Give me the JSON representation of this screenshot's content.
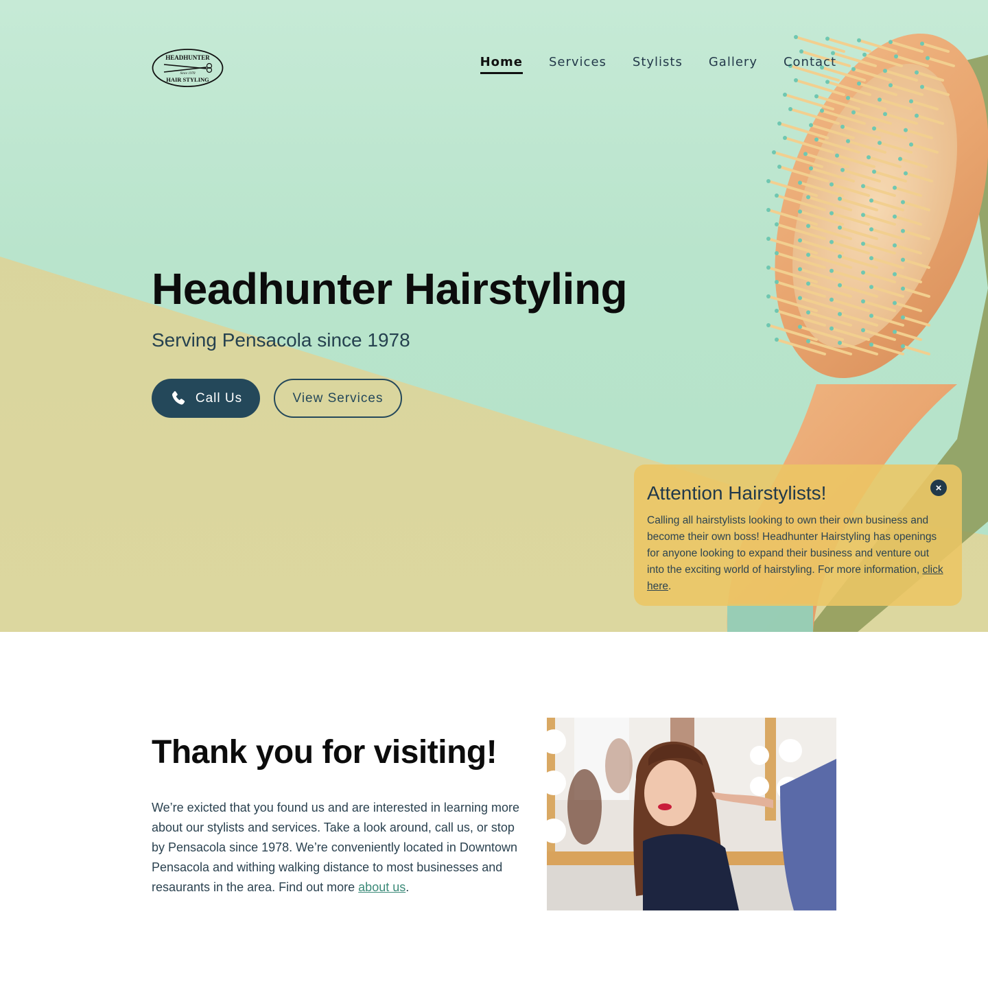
{
  "brand": {
    "logo_top": "HEADHUNTER",
    "logo_since": "Since 1978",
    "logo_bottom": "HAIR STYLING"
  },
  "nav": {
    "items": [
      {
        "label": "Home",
        "active": true
      },
      {
        "label": "Services",
        "active": false
      },
      {
        "label": "Stylists",
        "active": false
      },
      {
        "label": "Gallery",
        "active": false
      },
      {
        "label": "Contact",
        "active": false
      }
    ]
  },
  "hero": {
    "title": "Headhunter Hairstyling",
    "subtitle": "Serving Pensacola since 1978",
    "call_button": "Call Us",
    "call_icon": "phone-icon",
    "services_button": "View Services"
  },
  "notice": {
    "title": "Attention Hairstylists!",
    "body": "Calling all hairstylists looking to own their own business and become their own boss! Headhunter Hairstyling has openings for anyone looking to expand their business and venture out into the exciting world of hairstyling. For more information, ",
    "link": "click here",
    "trailing": ".",
    "close_icon": "close-icon"
  },
  "welcome": {
    "title": "Thank you for visiting!",
    "body": "We’re exicted that you found us and are interested in learning more about our stylists and services. Take a look around, call us, or stop by Pensacola since 1978. We’re conveniently located in Downtown Pensacola and withing walking distance to most businesses and resaurants in the area. Find out more ",
    "link": "about us",
    "trailing": "."
  },
  "colors": {
    "primary": "#24485a",
    "hero_green": "#b9e4cc",
    "hero_yellow": "#dcd79f",
    "notice_bg": "#ecc664",
    "link_green": "#3a8a78"
  }
}
